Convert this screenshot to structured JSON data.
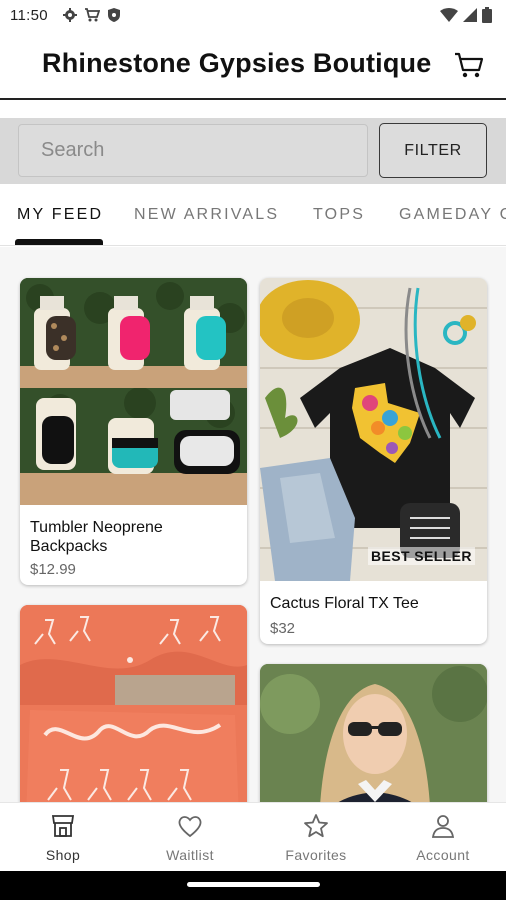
{
  "status": {
    "time": "11:50",
    "left_icons": [
      "gear-icon",
      "cart-status-icon",
      "shield-icon"
    ],
    "right_icons": [
      "wifi-icon",
      "signal-icon",
      "battery-icon"
    ]
  },
  "header": {
    "title": "Rhinestone Gypsies Boutique",
    "cart_icon": "shopping-cart-icon"
  },
  "search": {
    "placeholder": "Search",
    "value": "",
    "filter_label": "FILTER"
  },
  "tabs": [
    {
      "label": "MY FEED",
      "active": true
    },
    {
      "label": "NEW ARRIVALS",
      "active": false
    },
    {
      "label": "TOPS",
      "active": false
    },
    {
      "label": "GAMEDAY C",
      "active": false
    }
  ],
  "products": [
    {
      "title": "Tumbler Neoprene Backpacks",
      "price": "$12.99",
      "badge": ""
    },
    {
      "title": "Cactus Floral TX Tee",
      "price": "$32",
      "badge": "BEST SELLER"
    },
    {
      "title": "",
      "price": "",
      "badge": ""
    },
    {
      "title": "",
      "price": "",
      "badge": ""
    }
  ],
  "bottom_nav": [
    {
      "label": "Shop",
      "icon": "shop-icon",
      "active": true
    },
    {
      "label": "Waitlist",
      "icon": "heart-icon",
      "active": false
    },
    {
      "label": "Favorites",
      "icon": "star-icon",
      "active": false
    },
    {
      "label": "Account",
      "icon": "person-icon",
      "active": false
    }
  ],
  "colors": {
    "accent": "#111111",
    "search_bg": "#d8d8d8",
    "feed_bg": "#f6f6f6"
  }
}
